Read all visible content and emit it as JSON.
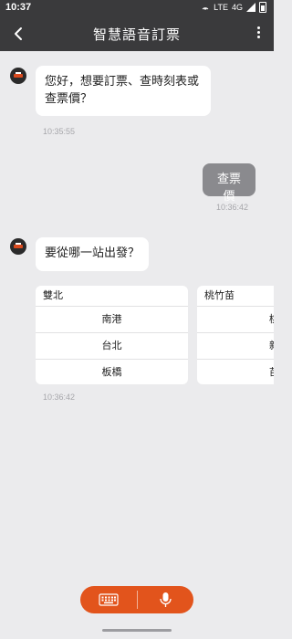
{
  "status_bar": {
    "time": "10:37",
    "network": "4G",
    "volte": "LTE"
  },
  "app_bar": {
    "title": "智慧語音訂票"
  },
  "messages": {
    "bot_greeting": {
      "line1": "您好，想要訂票、查時刻表或",
      "line2": "查票價？",
      "time": "10:35:55"
    },
    "user_reply": {
      "text": "查票價",
      "time": "10:36:42"
    },
    "bot_question": {
      "text": "要從哪一站出發？",
      "time": "10:36:42"
    }
  },
  "station_cards": [
    {
      "header": "雙北",
      "stations": [
        "南港",
        "台北",
        "板橋"
      ]
    },
    {
      "header": "桃竹苗",
      "stations": [
        "桃",
        "新",
        "苗"
      ]
    }
  ],
  "colors": {
    "app_bar": "#3a3a3c",
    "background": "#ebebed",
    "accent": "#e2541c",
    "user_bubble": "#8a8a8e"
  },
  "icons": {
    "back": "chevron-left-icon",
    "more": "more-vert-icon",
    "keyboard": "keyboard-icon",
    "mic": "microphone-icon"
  }
}
